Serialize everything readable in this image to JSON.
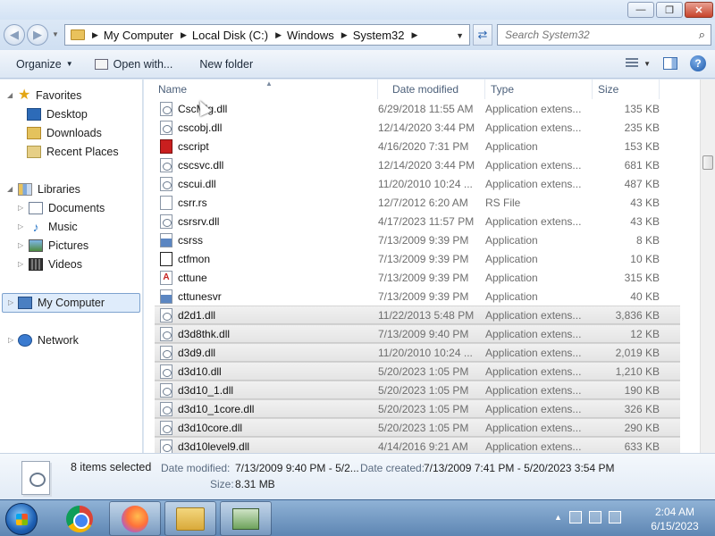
{
  "window": {
    "minimize_glyph": "—",
    "maximize_glyph": "❐",
    "close_glyph": "✕"
  },
  "address": {
    "breadcrumbs": [
      "My Computer",
      "Local Disk (C:)",
      "Windows",
      "System32"
    ],
    "search_placeholder": "Search System32"
  },
  "toolbar": {
    "organize": "Organize",
    "open_with": "Open with...",
    "new_folder": "New folder"
  },
  "nav": {
    "favorites": "Favorites",
    "desktop": "Desktop",
    "downloads": "Downloads",
    "recent_places": "Recent Places",
    "libraries": "Libraries",
    "documents": "Documents",
    "music": "Music",
    "pictures": "Pictures",
    "videos": "Videos",
    "my_computer": "My Computer",
    "network": "Network"
  },
  "columns": {
    "name": "Name",
    "date": "Date modified",
    "type": "Type",
    "size": "Size"
  },
  "files": [
    {
      "name": "CscMig.dll",
      "date": "6/29/2018 11:55 AM",
      "type": "Application extens...",
      "size": "135 KB",
      "icon": "dll-icon",
      "selected": false
    },
    {
      "name": "cscobj.dll",
      "date": "12/14/2020 3:44 PM",
      "type": "Application extens...",
      "size": "235 KB",
      "icon": "dll-icon",
      "selected": false
    },
    {
      "name": "cscript",
      "date": "4/16/2020 7:31 PM",
      "type": "Application",
      "size": "153 KB",
      "icon": "script-icon",
      "selected": false
    },
    {
      "name": "cscsvc.dll",
      "date": "12/14/2020 3:44 PM",
      "type": "Application extens...",
      "size": "681 KB",
      "icon": "dll-icon",
      "selected": false
    },
    {
      "name": "cscui.dll",
      "date": "11/20/2010 10:24 ...",
      "type": "Application extens...",
      "size": "487 KB",
      "icon": "dll-icon",
      "selected": false
    },
    {
      "name": "csrr.rs",
      "date": "12/7/2012 6:20 AM",
      "type": "RS File",
      "size": "43 KB",
      "icon": "file-icon",
      "selected": false
    },
    {
      "name": "csrsrv.dll",
      "date": "4/17/2023 11:57 PM",
      "type": "Application extens...",
      "size": "43 KB",
      "icon": "dll-icon",
      "selected": false
    },
    {
      "name": "csrss",
      "date": "7/13/2009 9:39 PM",
      "type": "Application",
      "size": "8 KB",
      "icon": "app-icon",
      "selected": false
    },
    {
      "name": "ctfmon",
      "date": "7/13/2009 9:39 PM",
      "type": "Application",
      "size": "10 KB",
      "icon": "ctfmon-icon",
      "selected": false
    },
    {
      "name": "cttune",
      "date": "7/13/2009 9:39 PM",
      "type": "Application",
      "size": "315 KB",
      "icon": "cttune-icon",
      "selected": false
    },
    {
      "name": "cttunesvr",
      "date": "7/13/2009 9:39 PM",
      "type": "Application",
      "size": "40 KB",
      "icon": "app-icon",
      "selected": false
    },
    {
      "name": "d2d1.dll",
      "date": "11/22/2013 5:48 PM",
      "type": "Application extens...",
      "size": "3,836 KB",
      "icon": "dll-icon",
      "selected": true
    },
    {
      "name": "d3d8thk.dll",
      "date": "7/13/2009 9:40 PM",
      "type": "Application extens...",
      "size": "12 KB",
      "icon": "dll-icon",
      "selected": true
    },
    {
      "name": "d3d9.dll",
      "date": "11/20/2010 10:24 ...",
      "type": "Application extens...",
      "size": "2,019 KB",
      "icon": "dll-icon",
      "selected": true
    },
    {
      "name": "d3d10.dll",
      "date": "5/20/2023 1:05 PM",
      "type": "Application extens...",
      "size": "1,210 KB",
      "icon": "dll-icon",
      "selected": true
    },
    {
      "name": "d3d10_1.dll",
      "date": "5/20/2023 1:05 PM",
      "type": "Application extens...",
      "size": "190 KB",
      "icon": "dll-icon",
      "selected": true
    },
    {
      "name": "d3d10_1core.dll",
      "date": "5/20/2023 1:05 PM",
      "type": "Application extens...",
      "size": "326 KB",
      "icon": "dll-icon",
      "selected": true
    },
    {
      "name": "d3d10core.dll",
      "date": "5/20/2023 1:05 PM",
      "type": "Application extens...",
      "size": "290 KB",
      "icon": "dll-icon",
      "selected": true
    },
    {
      "name": "d3d10level9.dll",
      "date": "4/14/2016 9:21 AM",
      "type": "Application extens...",
      "size": "633 KB",
      "icon": "dll-icon",
      "selected": true
    }
  ],
  "details": {
    "count": "8 items selected",
    "date_modified_label": "Date modified:",
    "date_modified_value": "7/13/2009 9:40 PM - 5/2...",
    "date_created_label": "Date created:",
    "date_created_value": "7/13/2009 7:41 PM - 5/20/2023 3:54 PM",
    "size_label": "Size:",
    "size_value": "8.31 MB"
  },
  "taskbar": {
    "time": "2:04 AM",
    "date": "6/15/2023",
    "apps": [
      "chrome-icon",
      "firefox-icon",
      "explorer-icon",
      "system-app-icon"
    ]
  }
}
